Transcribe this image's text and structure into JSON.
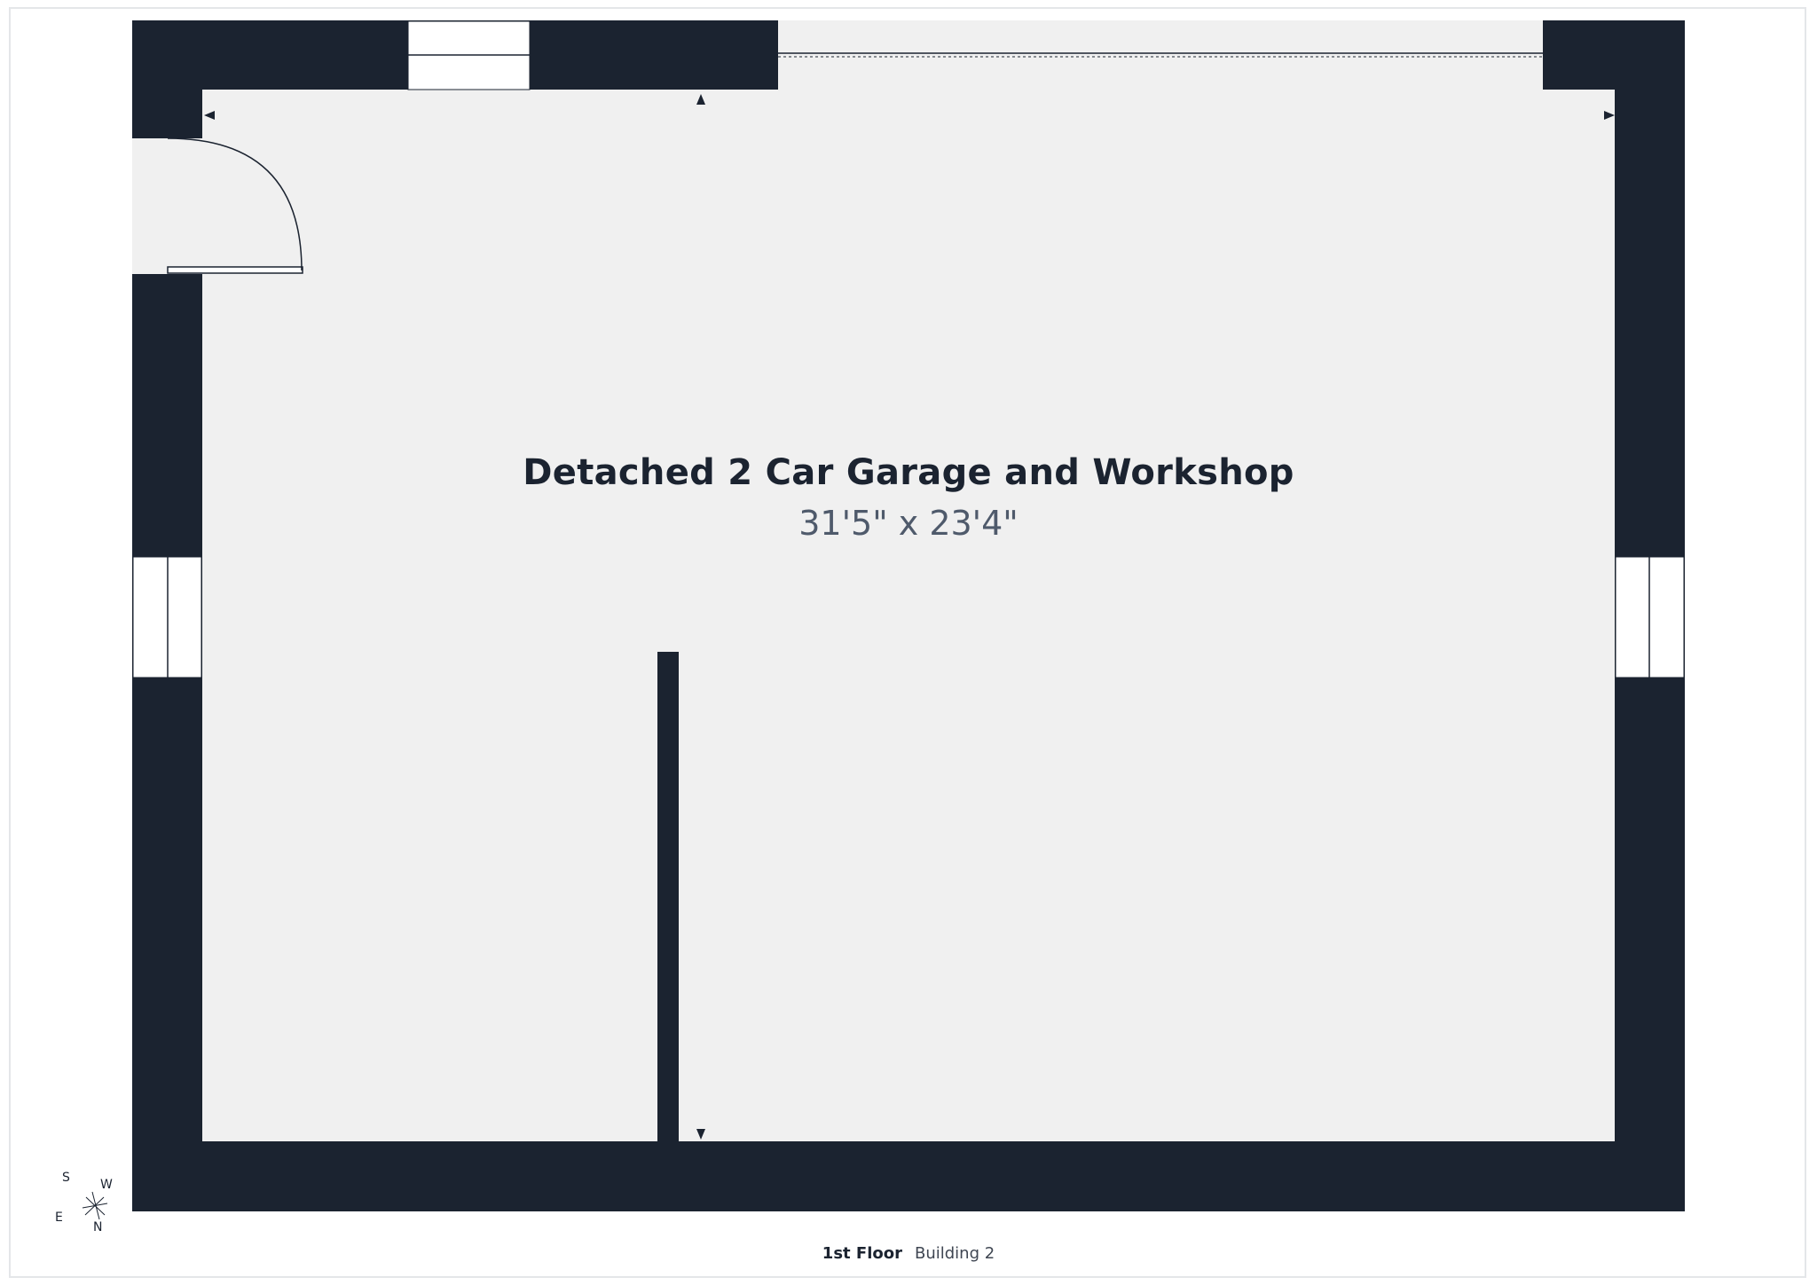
{
  "room": {
    "name": "Detached 2 Car Garage and Workshop",
    "dimensions": "31'5\" x 23'4\""
  },
  "footer": {
    "floor_label": "1st Floor",
    "building_label": "Building 2"
  },
  "compass": {
    "north": "N",
    "south": "S",
    "east": "E",
    "west": "W"
  },
  "colors": {
    "wall": "#1b2330",
    "floor": "#f0f0f0",
    "frame": "#e4e6e9"
  },
  "icons": [
    "compass-rose-icon",
    "dimension-arrow-icon"
  ]
}
